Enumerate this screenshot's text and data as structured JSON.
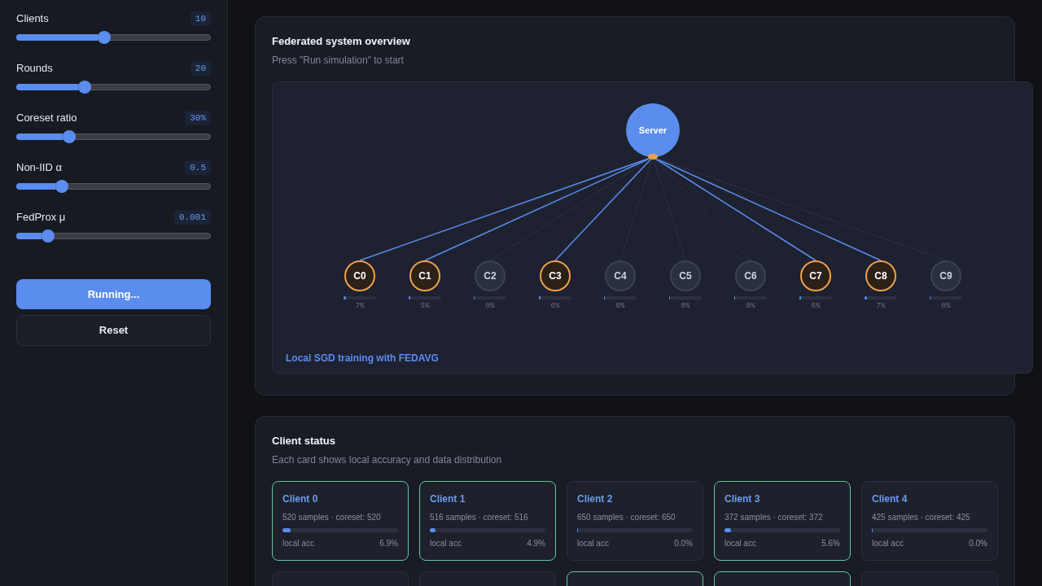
{
  "sidebar": {
    "sliders": [
      {
        "label": "Clients",
        "value": "10",
        "level": 0.45
      },
      {
        "label": "Rounds",
        "value": "20",
        "level": 0.35
      },
      {
        "label": "Coreset ratio",
        "value": "30%",
        "level": 0.27
      },
      {
        "label": "Non-IID α",
        "value": "0.5",
        "level": 0.23
      },
      {
        "label": "FedProx μ",
        "value": "0.001",
        "level": 0.16
      }
    ],
    "buttons": [
      {
        "label": "Running...",
        "kind": "primary"
      },
      {
        "label": "Reset",
        "kind": "secondary"
      }
    ]
  },
  "overview": {
    "title": "Federated system overview",
    "subtitle": "Press \"Run simulation\" to start",
    "diagram": {
      "server": "Server",
      "clients": [
        {
          "label": "C0",
          "active": true,
          "level": 0.07,
          "reading": "7%"
        },
        {
          "label": "C1",
          "active": true,
          "level": 0.05,
          "reading": "5%"
        },
        {
          "label": "C2",
          "active": false,
          "level": 0,
          "reading": "0%"
        },
        {
          "label": "C3",
          "active": true,
          "level": 0.06,
          "reading": "6%"
        },
        {
          "label": "C4",
          "active": false,
          "level": 0,
          "reading": "0%"
        },
        {
          "label": "C5",
          "active": false,
          "level": 0,
          "reading": "0%"
        },
        {
          "label": "C6",
          "active": false,
          "level": 0,
          "reading": "0%"
        },
        {
          "label": "C7",
          "active": true,
          "level": 0.06,
          "reading": "6%"
        },
        {
          "label": "C8",
          "active": true,
          "level": 0.07,
          "reading": "7%"
        },
        {
          "label": "C9",
          "active": false,
          "level": 0,
          "reading": "0%"
        }
      ],
      "caption": "Local SGD training with FEDAVG"
    }
  },
  "client_status": {
    "title": "Client status",
    "subtitle": "Each card shows local accuracy and data distribution",
    "cards": [
      {
        "name": "Client 0",
        "details": "520 samples · coreset: 520",
        "level": 0.069,
        "metric_label": "local acc",
        "metric_value": "6.9%",
        "active": true
      },
      {
        "name": "Client 1",
        "details": "516 samples · coreset: 516",
        "level": 0.049,
        "metric_label": "local acc",
        "metric_value": "4.9%",
        "active": true
      },
      {
        "name": "Client 2",
        "details": "650 samples · coreset: 650",
        "level": 0,
        "metric_label": "local acc",
        "metric_value": "0.0%",
        "active": false
      },
      {
        "name": "Client 3",
        "details": "372 samples · coreset: 372",
        "level": 0.056,
        "metric_label": "local acc",
        "metric_value": "5.6%",
        "active": true
      },
      {
        "name": "Client 4",
        "details": "425 samples · coreset: 425",
        "level": 0,
        "metric_label": "local acc",
        "metric_value": "0.0%",
        "active": false
      },
      {
        "active": false
      },
      {
        "active": false
      },
      {
        "active": true
      },
      {
        "active": true
      },
      {
        "active": false
      }
    ]
  }
}
